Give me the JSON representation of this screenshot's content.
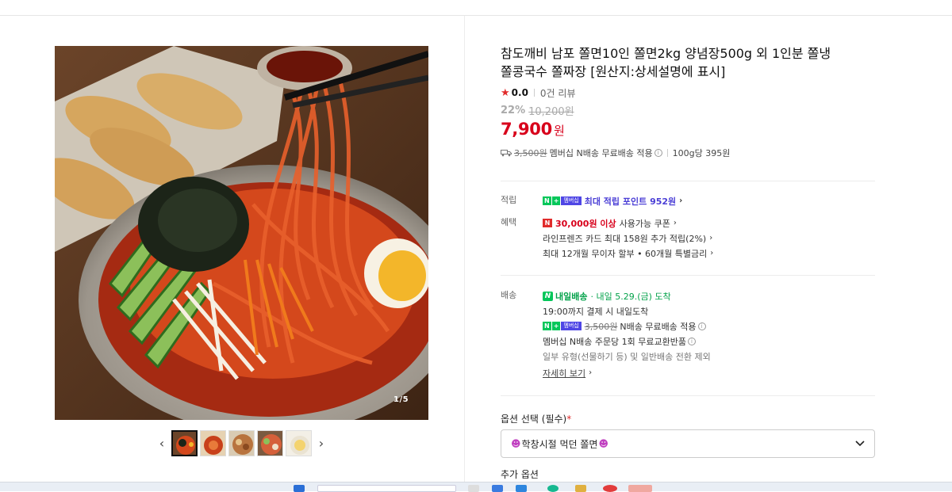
{
  "product": {
    "title": "참도깨비 남포 쫄면10인 쫄면2kg 양념장500g 외 1인분 쫄냉쫄콩국수 쫄짜장 [원산지:상세설명에 표시]",
    "title_line1": "참도깨비 남포 쫄면10인 쫄면2kg 양념장500g 외 1인분 쫄냉",
    "title_line2": "쫄콩국수 쫄짜장 [원산지:상세설명에 표시]",
    "rating_score": "0.0",
    "review_count": "0건 리뷰",
    "discount_rate": "22%",
    "original_price": "10,200원",
    "sale_price": "7,900",
    "price_unit": "원"
  },
  "shipping_summary": {
    "fee_struck": "3,500원",
    "member_text": "멤버십 N배송 무료배송 적용",
    "unit_price": "100g당 395원"
  },
  "gallery": {
    "counter_current": "1",
    "counter_total": "/5",
    "thumbnail_count": 5
  },
  "points": {
    "label": "적립",
    "text": "최대 적립 포인트 952원",
    "badge_n": "N",
    "badge_plus": "+",
    "badge_member": "멤버십"
  },
  "benefits": {
    "label": "혜택",
    "coupon_amount": "30,000원 이상",
    "coupon_text": "사용가능 쿠폰",
    "card_text": "라인프렌즈 카드 최대 158원 추가 적립(2%)",
    "installment_text": "최대 12개월 무이자 할부 • 60개월 특별금리",
    "n_icon": "N"
  },
  "delivery": {
    "label": "배송",
    "service_name": "내일배송",
    "arrival": "· 내일 5.29.(금) 도착",
    "cutoff": "19:00까지 결제 시 내일도착",
    "fee_struck": "3,500원",
    "fee_text": "N배송 무료배송 적용",
    "exchange_text": "멤버십 N배송 주문당 1회 무료교환반품",
    "exclusion_text": "일부 유형(선물하기 등) 및 일반배송 전환 제외",
    "more_link": "자세히 보기"
  },
  "options": {
    "label": "옵션 선택 (필수)",
    "required_mark": "*",
    "selected": "학창시절 먹던 쫄면",
    "additional_label": "추가 옵션"
  },
  "colors": {
    "price_red": "#d8001b",
    "naver_green": "#03c75a",
    "point_purple": "#4b3fd6"
  }
}
